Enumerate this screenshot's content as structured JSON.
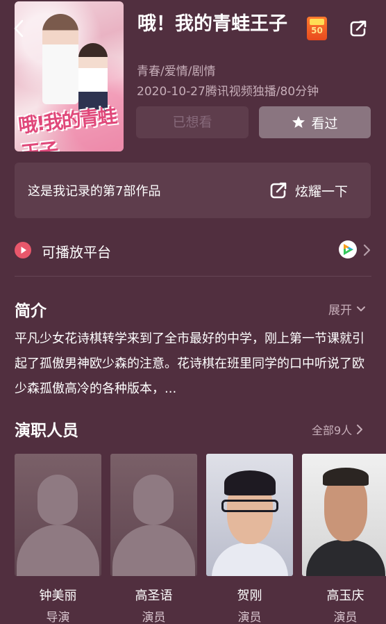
{
  "header": {
    "title": "哦！我的青蛙王子",
    "badge_number": "50",
    "genre": "青春/爱情/剧情",
    "meta": "2020-10-27腾讯视频独播/80分钟",
    "want_label": "已想看",
    "seen_label": "看过",
    "poster_title": "哦!我的青蛙王子"
  },
  "record": {
    "text": "这是我记录的第7部作品",
    "share_label": "炫耀一下"
  },
  "platform": {
    "label": "可播放平台"
  },
  "synopsis": {
    "title": "简介",
    "expand_label": "展开",
    "body": "平凡少女花诗棋转学来到了全市最好的中学，刚上第一节课就引起了孤傲男神欧少森的注意。花诗棋在班里同学的口中听说了欧少森孤傲高冷的各种版本，..."
  },
  "cast": {
    "title": "演职人员",
    "all_label": "全部9人",
    "members": [
      {
        "name": "钟美丽",
        "role": "导演"
      },
      {
        "name": "高圣语",
        "role": "演员"
      },
      {
        "name": "贺刚",
        "role": "演员"
      },
      {
        "name": "高玉庆",
        "role": "演员"
      }
    ]
  },
  "colors": {
    "background": "#512f3f",
    "card": "#5e3d4c",
    "muted_text": "#c7aeb9",
    "play_red": "#e8576b"
  }
}
